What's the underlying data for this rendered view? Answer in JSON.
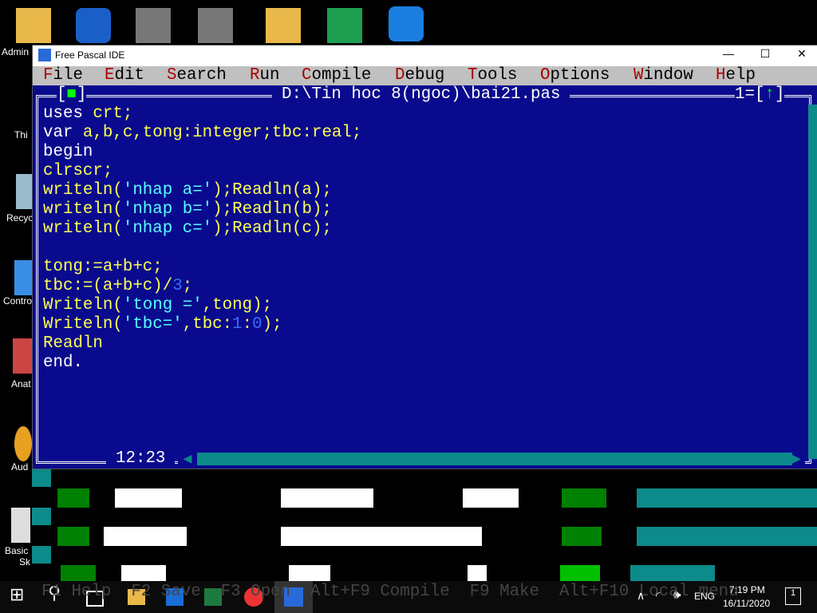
{
  "desktop": {
    "icons": [
      {
        "label": "Admin"
      },
      {
        "label": "Thi"
      },
      {
        "label": "Recyc"
      },
      {
        "label": "Contro"
      },
      {
        "label": "Anat"
      },
      {
        "label": "Aud"
      },
      {
        "label": "Basic"
      },
      {
        "label": "Sk"
      }
    ]
  },
  "window": {
    "title": "Free Pascal IDE",
    "minimize": "—",
    "maximize": "☐",
    "close": "✕"
  },
  "menu": [
    {
      "h": "F",
      "r": "ile"
    },
    {
      "h": "E",
      "r": "dit"
    },
    {
      "h": "S",
      "r": "earch"
    },
    {
      "h": "R",
      "r": "un"
    },
    {
      "h": "C",
      "r": "ompile"
    },
    {
      "h": "D",
      "r": "ebug"
    },
    {
      "h": "T",
      "r": "ools"
    },
    {
      "h": "O",
      "r": "ptions"
    },
    {
      "h": "W",
      "r": "indow"
    },
    {
      "h": "H",
      "r": "elp"
    }
  ],
  "editor": {
    "path": "D:\\Tin hoc 8(ngoc)\\bai21.pas",
    "window_number": "1",
    "zoom_arrow": "↑",
    "cursor_pos": "12:23",
    "lines": [
      [
        [
          "uses ",
          "w"
        ],
        [
          "crt;",
          "y"
        ]
      ],
      [
        [
          "var ",
          "w"
        ],
        [
          "a,b,c,tong:integer;tbc:real;",
          "y"
        ]
      ],
      [
        [
          "begin",
          "w"
        ]
      ],
      [
        [
          "clrscr;",
          "y"
        ]
      ],
      [
        [
          "writeln(",
          "y"
        ],
        [
          "'nhap a='",
          "c"
        ],
        [
          ");Readln(a);",
          "y"
        ]
      ],
      [
        [
          "writeln(",
          "y"
        ],
        [
          "'nhap b='",
          "c"
        ],
        [
          ");Readln(b);",
          "y"
        ]
      ],
      [
        [
          "writeln(",
          "y"
        ],
        [
          "'nhap c='",
          "c"
        ],
        [
          ");Readln(c);",
          "y"
        ]
      ],
      [],
      [
        [
          "tong:=a+b+c;",
          "y"
        ]
      ],
      [
        [
          "tbc:=(a+b+c)/",
          "y"
        ],
        [
          "3",
          "n"
        ],
        [
          ";",
          "y"
        ]
      ],
      [
        [
          "Writeln(",
          "y"
        ],
        [
          "'tong ='",
          "c"
        ],
        [
          ",tong);",
          "y"
        ]
      ],
      [
        [
          "Writeln(",
          "y"
        ],
        [
          "'tbc='",
          "c"
        ],
        [
          ",tbc:",
          "y"
        ],
        [
          "1",
          "n"
        ],
        [
          ":",
          "y"
        ],
        [
          "0",
          "n"
        ],
        [
          ");",
          "y"
        ]
      ],
      [
        [
          "Readln",
          "y"
        ]
      ],
      [
        [
          "end.",
          "w"
        ]
      ]
    ]
  },
  "statusbar": {
    "text": "F1 Help  F2 Save  F3 Open  Alt+F9 Compile  F9 Make  Alt+F10 Local menu"
  },
  "taskbar": {
    "language": "ENG",
    "time": "7:19 PM",
    "date": "16/11/2020",
    "notifications": "1"
  }
}
